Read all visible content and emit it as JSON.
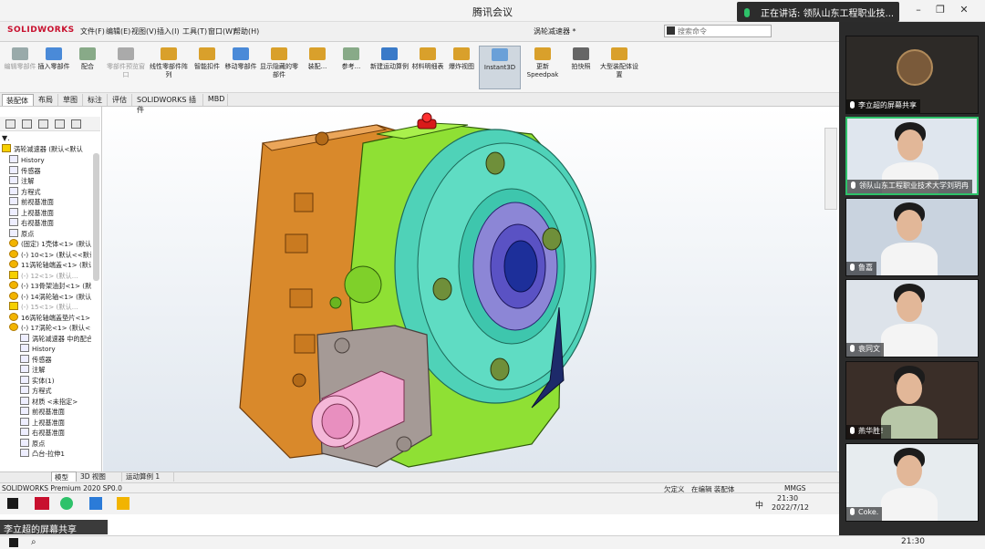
{
  "meeting": {
    "title": "腾讯会议",
    "speaking_label": "正在讲话: 领队山东工程职业技..."
  },
  "solidworks": {
    "logo": "SOLIDWORKS",
    "menu": [
      "文件(F)",
      "编辑(E)",
      "视图(V)",
      "插入(I)",
      "工具(T)",
      "窗口(W)",
      "帮助(H)"
    ],
    "document_title": "涡轮减速器 *",
    "search_placeholder": "搜索命令",
    "ribbon": [
      {
        "label": "编辑零部件",
        "dim": true
      },
      {
        "label": "插入零部件"
      },
      {
        "label": "配合"
      },
      {
        "label": "零部件预览窗口",
        "dim": true
      },
      {
        "label": "线性零部件阵列"
      },
      {
        "label": "智能扣件"
      },
      {
        "label": "移动零部件"
      },
      {
        "label": "显示隐藏的零部件"
      },
      {
        "label": "装配..."
      },
      {
        "label": "参考..."
      },
      {
        "label": "新建运动算例"
      },
      {
        "label": "材料明细表"
      },
      {
        "label": "爆炸视图"
      },
      {
        "label": "Instant3D"
      },
      {
        "label": "更新Speedpak"
      },
      {
        "label": "拍快照"
      },
      {
        "label": "大型装配体设置"
      }
    ],
    "tabs": [
      "装配体",
      "布局",
      "草图",
      "标注",
      "评估",
      "SOLIDWORKS 插件",
      "MBD"
    ],
    "tree_root": "涡轮减速器 (默认<默认",
    "tree": [
      {
        "label": "History",
        "icon": "history"
      },
      {
        "label": "传感器",
        "icon": "sensor"
      },
      {
        "label": "注解",
        "icon": "annotation"
      },
      {
        "label": "方程式",
        "icon": "equation"
      },
      {
        "label": "前视基准面",
        "icon": "plane"
      },
      {
        "label": "上视基准面",
        "icon": "plane"
      },
      {
        "label": "右视基准面",
        "icon": "plane"
      },
      {
        "label": "原点",
        "icon": "origin"
      },
      {
        "label": "(固定) 1壳体<1> (默认...",
        "icon": "part"
      },
      {
        "label": "(-) 10<1> (默认<<默认...",
        "icon": "part"
      },
      {
        "label": "11涡轮轴端盖<1> (默认...",
        "icon": "part"
      },
      {
        "label": "(-) 12<1> (默认...",
        "icon": "warning",
        "grey": true
      },
      {
        "label": "(-) 13骨架油封<1> (默认...",
        "icon": "part"
      },
      {
        "label": "(-) 14涡轮轴<1> (默认...",
        "icon": "part"
      },
      {
        "label": "(-) 15<1> (默认...",
        "icon": "warning",
        "grey": true
      },
      {
        "label": "16涡轮轴端盖垫片<1> (...",
        "icon": "part"
      },
      {
        "label": "(-) 17涡轮<1> (默认<<...",
        "icon": "part"
      },
      {
        "label": "涡轮减速器 中的配合",
        "icon": "mates"
      },
      {
        "label": "History",
        "icon": "history"
      },
      {
        "label": "传感器",
        "icon": "sensor"
      },
      {
        "label": "注解",
        "icon": "annotation"
      },
      {
        "label": "实体(1)",
        "icon": "solid"
      },
      {
        "label": "方程式",
        "icon": "equation"
      },
      {
        "label": "材质 <未指定>",
        "icon": "material"
      },
      {
        "label": "前视基准面",
        "icon": "plane"
      },
      {
        "label": "上视基准面",
        "icon": "plane"
      },
      {
        "label": "右视基准面",
        "icon": "plane"
      },
      {
        "label": "原点",
        "icon": "origin"
      },
      {
        "label": "凸台-拉伸1",
        "icon": "extrude"
      }
    ],
    "bottom_tabs": [
      "模型",
      "3D 视图",
      "运动算例 1"
    ],
    "status": {
      "version": "SOLIDWORKS Premium 2020 SP0.0",
      "state1": "欠定义",
      "state2": "在编辑 装配体",
      "units": "MMGS"
    },
    "taskbar": {
      "time": "21:30",
      "date": "2022/7/12",
      "ime": "中"
    }
  },
  "share_label": "李立超的屏幕共享",
  "participants": [
    {
      "name": "李立超的屏幕共享",
      "speaking": false
    },
    {
      "name": "领队山东工程职业技术大学刘玥冉",
      "speaking": true
    },
    {
      "name": "鲁嘉",
      "speaking": false
    },
    {
      "name": "袁同文",
      "speaking": false
    },
    {
      "name": "燕华胜！",
      "speaking": false
    },
    {
      "name": "Coke.",
      "speaking": false
    }
  ],
  "host_taskbar": {
    "time": "21:30"
  }
}
